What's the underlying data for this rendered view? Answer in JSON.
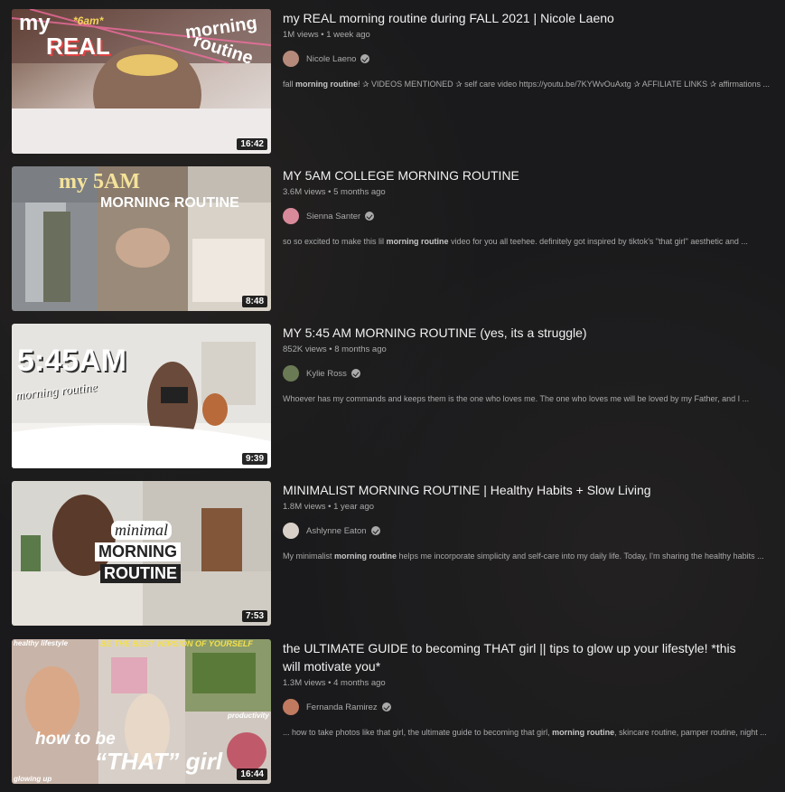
{
  "videos": [
    {
      "title": "my REAL morning routine during FALL 2021 | Nicole Laeno",
      "views": "1M views",
      "age": "1 week ago",
      "channel": "Nicole Laeno",
      "duration": "16:42",
      "desc_pre": "fall ",
      "desc_bold": "morning routine",
      "desc_post": "! ✰ VIDEOS MENTIONED ✰ self care video https://youtu.be/7KYWvOuAxtg ✰ AFFILIATE LINKS ✰ affirmations ...",
      "thumb_text": [
        "my",
        "REAL",
        "*6am*",
        "morning",
        "routine"
      ],
      "avatar_color": "#b58a7a"
    },
    {
      "title": "MY 5AM COLLEGE MORNING ROUTINE",
      "views": "3.6M views",
      "age": "5 months ago",
      "channel": "Sienna Santer",
      "duration": "8:48",
      "desc_pre": "so so excited to make this lil ",
      "desc_bold": "morning routine",
      "desc_post": " video for you all teehee. definitely got inspired by tiktok's \"that girl\" aesthetic and ...",
      "thumb_text": [
        "my 5AM",
        "MORNING ROUTINE"
      ],
      "avatar_color": "#d98a9a"
    },
    {
      "title": "MY 5:45 AM MORNING ROUTINE (yes, its a struggle)",
      "views": "852K views",
      "age": "8 months ago",
      "channel": "Kylie Ross",
      "duration": "9:39",
      "desc_pre": "Whoever has my commands and keeps them is the one who loves me. The one who loves me will be loved by my Father, and I ...",
      "desc_bold": "",
      "desc_post": "",
      "thumb_text": [
        "5:45AM",
        "morning routine"
      ],
      "avatar_color": "#6a7a55"
    },
    {
      "title": "MINIMALIST MORNING ROUTINE | Healthy Habits + Slow Living",
      "views": "1.8M views",
      "age": "1 year ago",
      "channel": "Ashlynne Eaton",
      "duration": "7:53",
      "desc_pre": "My minimalist ",
      "desc_bold": "morning routine",
      "desc_post": " helps me incorporate simplicity and self-care into my daily life. Today, I'm sharing the healthy habits ...",
      "thumb_text": [
        "minimal",
        "MORNING",
        "ROUTINE"
      ],
      "avatar_color": "#d8d0c8"
    },
    {
      "title": "the ULTIMATE GUIDE to becoming THAT girl || tips to glow up your lifestyle! *this will motivate you*",
      "views": "1.3M views",
      "age": "4 months ago",
      "channel": "Fernanda Ramirez",
      "duration": "16:44",
      "desc_pre": "... how to take photos like that girl, the ultimate guide to becoming that girl, ",
      "desc_bold": "morning routine",
      "desc_post": ", skincare routine, pamper routine, night ...",
      "thumb_text": [
        "healthy lifestyle",
        "BE THE BEST VERSION OF YOURSELF",
        "how to be",
        "“THAT” girl",
        "productivity",
        "glowing up"
      ],
      "avatar_color": "#c07a60"
    }
  ],
  "separator": "•",
  "colors": {
    "background": "#1a1a1c",
    "title": "#f1f1f1",
    "meta": "#aaaaaa"
  }
}
